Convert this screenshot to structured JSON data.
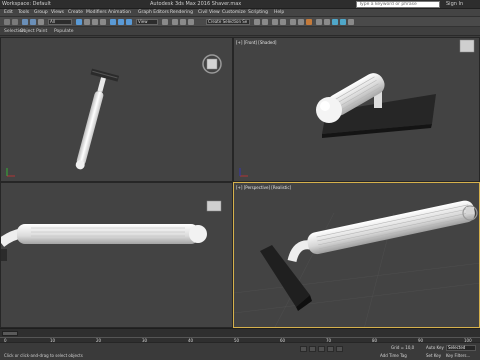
{
  "app": {
    "workspace": "Workspace: Default",
    "title": "Autodesk 3ds Max 2016    Shaver.max",
    "search_placeholder": "Type a keyword or phrase",
    "sign_in": "Sign In"
  },
  "menu": [
    "Edit",
    "Tools",
    "Group",
    "Views",
    "Create",
    "Modifiers",
    "Animation",
    "Graph Editors",
    "Rendering",
    "Civil View",
    "Customize",
    "Scripting",
    "Help"
  ],
  "toolbar": {
    "selection_filter": "All",
    "view_dropdown": "View",
    "named_selection": "Create Selection Se"
  },
  "ribbon": [
    "Selection",
    "Object Paint",
    "Populate"
  ],
  "viewports": {
    "top_right": "[+] [Front] [Shaded]",
    "bottom_right": "[+] [Perspective] [Realistic]"
  },
  "status": {
    "hint": "Click or click-and-drag to select objects",
    "add_time_tag": "Add Time Tag",
    "auto_key": "Auto Key",
    "set_key": "Set Key",
    "selected": "Selected",
    "key_filters": "Key Filters...",
    "grid": "Grid = 10,0"
  },
  "timeline": {
    "ticks": [
      "0",
      "10",
      "20",
      "30",
      "40",
      "50",
      "60",
      "70",
      "80",
      "90",
      "100"
    ]
  },
  "colors": {
    "viewport_bg": "#434343",
    "active_border": "#d6b14c",
    "model": "#f2f2f2",
    "head": "#2b2b2b"
  }
}
